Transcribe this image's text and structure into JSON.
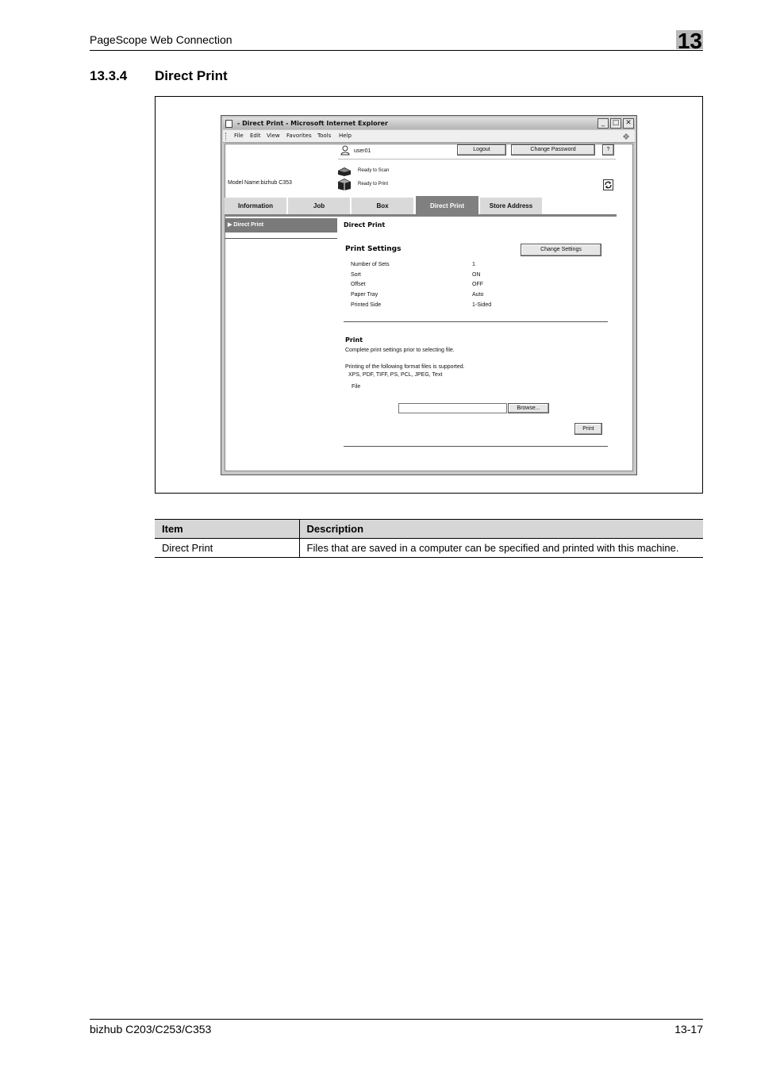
{
  "header": {
    "title": "PageScope Web Connection",
    "chapter": "13"
  },
  "section": {
    "number": "13.3.4",
    "title": "Direct Print"
  },
  "browser": {
    "window_title": "- Direct Print - Microsoft Internet Explorer",
    "menu": [
      "File",
      "Edit",
      "View",
      "Favorites",
      "Tools",
      "Help"
    ],
    "user": "user01",
    "logout_label": "Logout",
    "change_password_label": "Change Password",
    "help_label": "?",
    "model_name": "Model Name:bizhub C353",
    "status_scan": "Ready to Scan",
    "status_print": "Ready to Print",
    "tabs": [
      "Information",
      "Job",
      "Box",
      "Direct Print",
      "Store Address"
    ],
    "active_tab": "Direct Print",
    "side_menu_item": "Direct Print",
    "page_heading": "Direct Print",
    "print_settings": {
      "heading": "Print Settings",
      "change_settings_label": "Change Settings",
      "rows": [
        {
          "label": "Number of Sets",
          "value": "1"
        },
        {
          "label": "Sort",
          "value": "ON"
        },
        {
          "label": "Offset",
          "value": "OFF"
        },
        {
          "label": "Paper Tray",
          "value": "Auto"
        },
        {
          "label": "Printed Side",
          "value": "1-Sided"
        }
      ]
    },
    "print": {
      "heading": "Print",
      "note1": "Complete print settings prior to selecting file.",
      "note2": "Printing of the following format files is supported.",
      "formats": "XPS, PDF, TIFF, PS, PCL, JPEG, Text",
      "file_label": "File",
      "browse_label": "Browse...",
      "print_label": "Print"
    }
  },
  "table": {
    "headers": [
      "Item",
      "Description"
    ],
    "rows": [
      [
        "Direct Print",
        "Files that are saved in a computer can be specified and printed with this machine."
      ]
    ]
  },
  "footer": {
    "left": "bizhub C203/C253/C353",
    "right": "13-17"
  }
}
